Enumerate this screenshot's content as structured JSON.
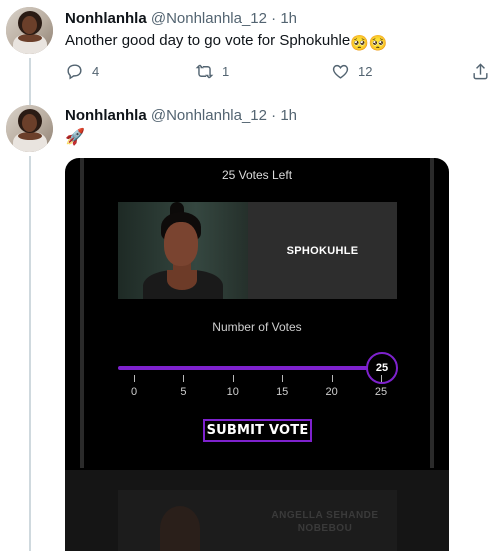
{
  "tweets": [
    {
      "name": "Nonhlanhla",
      "handle": "@Nonhlanhla_12",
      "separator": "·",
      "time": "1h",
      "text": "Another good day to go vote for Sphokuhle",
      "emoji": "🥺🥺",
      "reply_count": "4",
      "retweet_count": "1",
      "like_count": "12"
    },
    {
      "name": "Nonhlanhla",
      "handle": "@Nonhlanhla_12",
      "separator": "·",
      "time": "1h",
      "text": "🚀"
    }
  ],
  "vote_card": {
    "votes_left": "25 Votes Left",
    "contestant_name": "SPHOKUHLE",
    "number_of_votes_label": "Number of Votes",
    "slider_value": 25,
    "slider_max": 25,
    "slider_display": "25",
    "ticks": [
      "0",
      "5",
      "10",
      "15",
      "20",
      "25"
    ],
    "submit_label": "SUBMIT VOTE",
    "next_contestant_partial": "ANGELLA SEHANDE\nNOBEBOU"
  },
  "colors": {
    "accent_purple": "#7e22ce",
    "twitter_gray": "#536471",
    "thread_line": "#cfd9de"
  },
  "icons": [
    "reply-icon",
    "retweet-icon",
    "like-icon",
    "share-icon",
    "rocket-emoji"
  ]
}
